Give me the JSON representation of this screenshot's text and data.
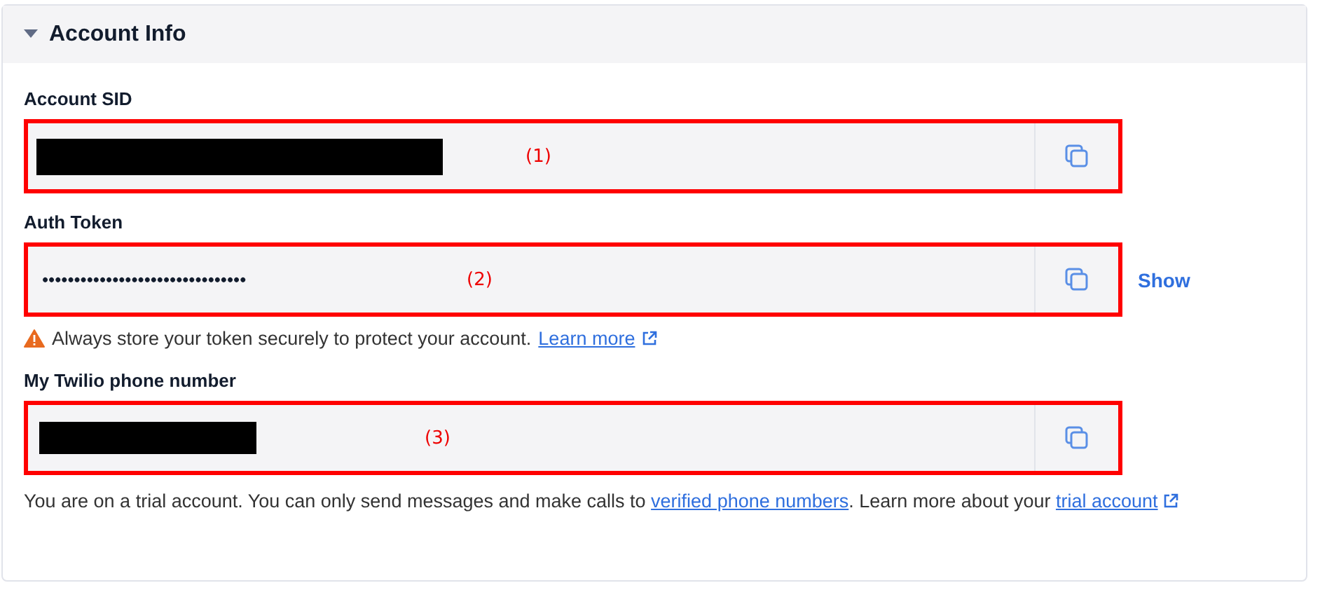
{
  "panel": {
    "title": "Account Info",
    "expanded": true
  },
  "fields": [
    {
      "label": "Account SID",
      "kind": "redacted",
      "annotation": "(1)"
    },
    {
      "label": "Auth Token",
      "kind": "masked",
      "value": "••••••••••••••••••••••••••••••••",
      "annotation": "(2)",
      "action": "Show",
      "note": {
        "text": "Always store your token securely to protect your account.",
        "link": "Learn more"
      }
    },
    {
      "label": "My Twilio phone number",
      "kind": "redacted",
      "annotation": "(3)"
    }
  ],
  "footer": {
    "parts": [
      {
        "kind": "text",
        "text": "You are on a trial account. You can only send messages and make calls to "
      },
      {
        "kind": "link",
        "text": "verified phone numbers"
      },
      {
        "kind": "text",
        "text": ". Learn more about your "
      },
      {
        "kind": "external",
        "text": "trial account"
      }
    ]
  }
}
